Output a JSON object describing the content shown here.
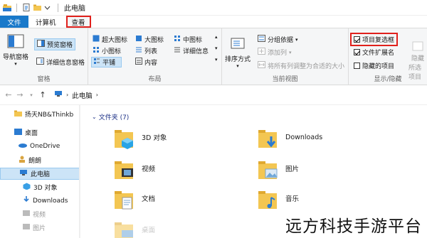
{
  "titlebar": {
    "title": "此电脑"
  },
  "tabs": {
    "file": "文件",
    "computer": "计算机",
    "view": "查看"
  },
  "ribbon": {
    "panes": {
      "nav_pane": "导航窗格",
      "preview_pane": "预览窗格",
      "details_pane": "详细信息窗格",
      "label": "窗格"
    },
    "layout": {
      "xl_icons": "超大图标",
      "large_icons": "大图标",
      "medium_icons": "中图标",
      "small_icons": "小图标",
      "list": "列表",
      "details": "详细信息",
      "tiles": "平铺",
      "content": "内容",
      "label": "布局"
    },
    "current_view": {
      "sort": "排序方式",
      "group_by": "分组依据",
      "add_column": "添加列",
      "fit_columns": "将所有列调整为合适的大小",
      "label": "当前视图"
    },
    "show_hide": {
      "item_checkboxes": "项目复选框",
      "file_ext": "文件扩展名",
      "hidden_items": "隐藏的项目",
      "hide": "隐藏",
      "hide_selected": "所选项目",
      "label": "显示/隐藏"
    }
  },
  "address": {
    "crumb": "此电脑"
  },
  "sidebar": {
    "items": [
      "扬天NB&Thinkb",
      "桌面",
      "OneDrive",
      "朗朗",
      "此电脑",
      "3D 对象",
      "Downloads",
      "视频",
      "图片"
    ]
  },
  "main": {
    "group_header": "文件夹 (7)",
    "folders": [
      "3D 对象",
      "Downloads",
      "视频",
      "图片",
      "文档",
      "音乐",
      "桌面"
    ]
  },
  "watermark": "远方科技手游平台",
  "colors": {
    "accent": "#1979ca",
    "highlight": "#e0201c",
    "folder": "#f3c652"
  }
}
